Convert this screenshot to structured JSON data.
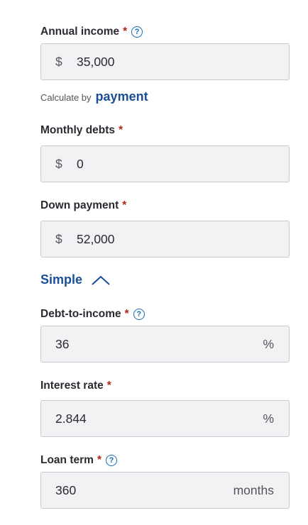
{
  "annual_income": {
    "label": "Annual income",
    "required_mark": "*",
    "help_glyph": "?",
    "prefix": "$",
    "value": "35,000"
  },
  "calculate_by": {
    "prefix_text": "Calculate by",
    "link_text": "payment"
  },
  "monthly_debts": {
    "label": "Monthly debts",
    "required_mark": "*",
    "prefix": "$",
    "value": "0"
  },
  "down_payment": {
    "label": "Down payment",
    "required_mark": "*",
    "prefix": "$",
    "value": "52,000"
  },
  "mode_toggle": {
    "label": "Simple",
    "icon": "chevron-up-icon"
  },
  "debt_to_income": {
    "label": "Debt-to-income",
    "required_mark": "*",
    "help_glyph": "?",
    "value": "36",
    "suffix": "%"
  },
  "interest_rate": {
    "label": "Interest rate",
    "required_mark": "*",
    "value": "2.844",
    "suffix": "%"
  },
  "loan_term": {
    "label": "Loan term",
    "required_mark": "*",
    "help_glyph": "?",
    "value": "360",
    "suffix": "months"
  },
  "colors": {
    "accent": "#1a4e96",
    "required": "#b3261e",
    "input_bg": "#f2f2f4",
    "input_border": "#c9c9cf"
  }
}
